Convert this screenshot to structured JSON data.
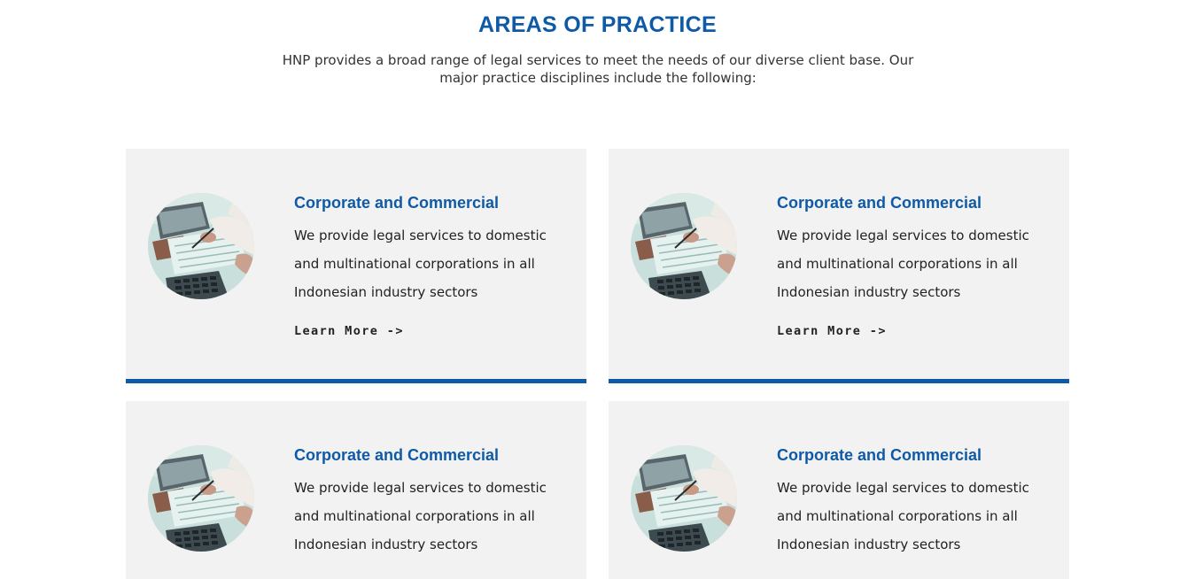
{
  "section": {
    "title": "AREAS OF PRACTICE",
    "intro": "HNP provides a broad range of legal services to meet the needs of our diverse client base. Our major practice disciplines include the following:"
  },
  "colors": {
    "accent": "#0f5aa6",
    "card_background": "#f2f2f2",
    "body_text": "#222222"
  },
  "cards": [
    {
      "title": "Corporate and Commercial",
      "description": "We provide legal services to domestic and multinational corporations in all Indonesian industry sectors",
      "link_label": "Learn More ->",
      "image_alt": "laptop-and-documents-photo"
    },
    {
      "title": "Corporate and Commercial",
      "description": "We provide legal services to domestic and multinational corporations in all Indonesian industry sectors",
      "link_label": "Learn More ->",
      "image_alt": "laptop-and-documents-photo"
    },
    {
      "title": "Corporate and Commercial",
      "description": "We provide legal services to domestic and multinational corporations in all Indonesian industry sectors",
      "link_label": "",
      "image_alt": "laptop-and-documents-photo"
    },
    {
      "title": "Corporate and Commercial",
      "description": "We provide legal services to domestic and multinational corporations in all Indonesian industry sectors",
      "link_label": "",
      "image_alt": "laptop-and-documents-photo"
    }
  ]
}
